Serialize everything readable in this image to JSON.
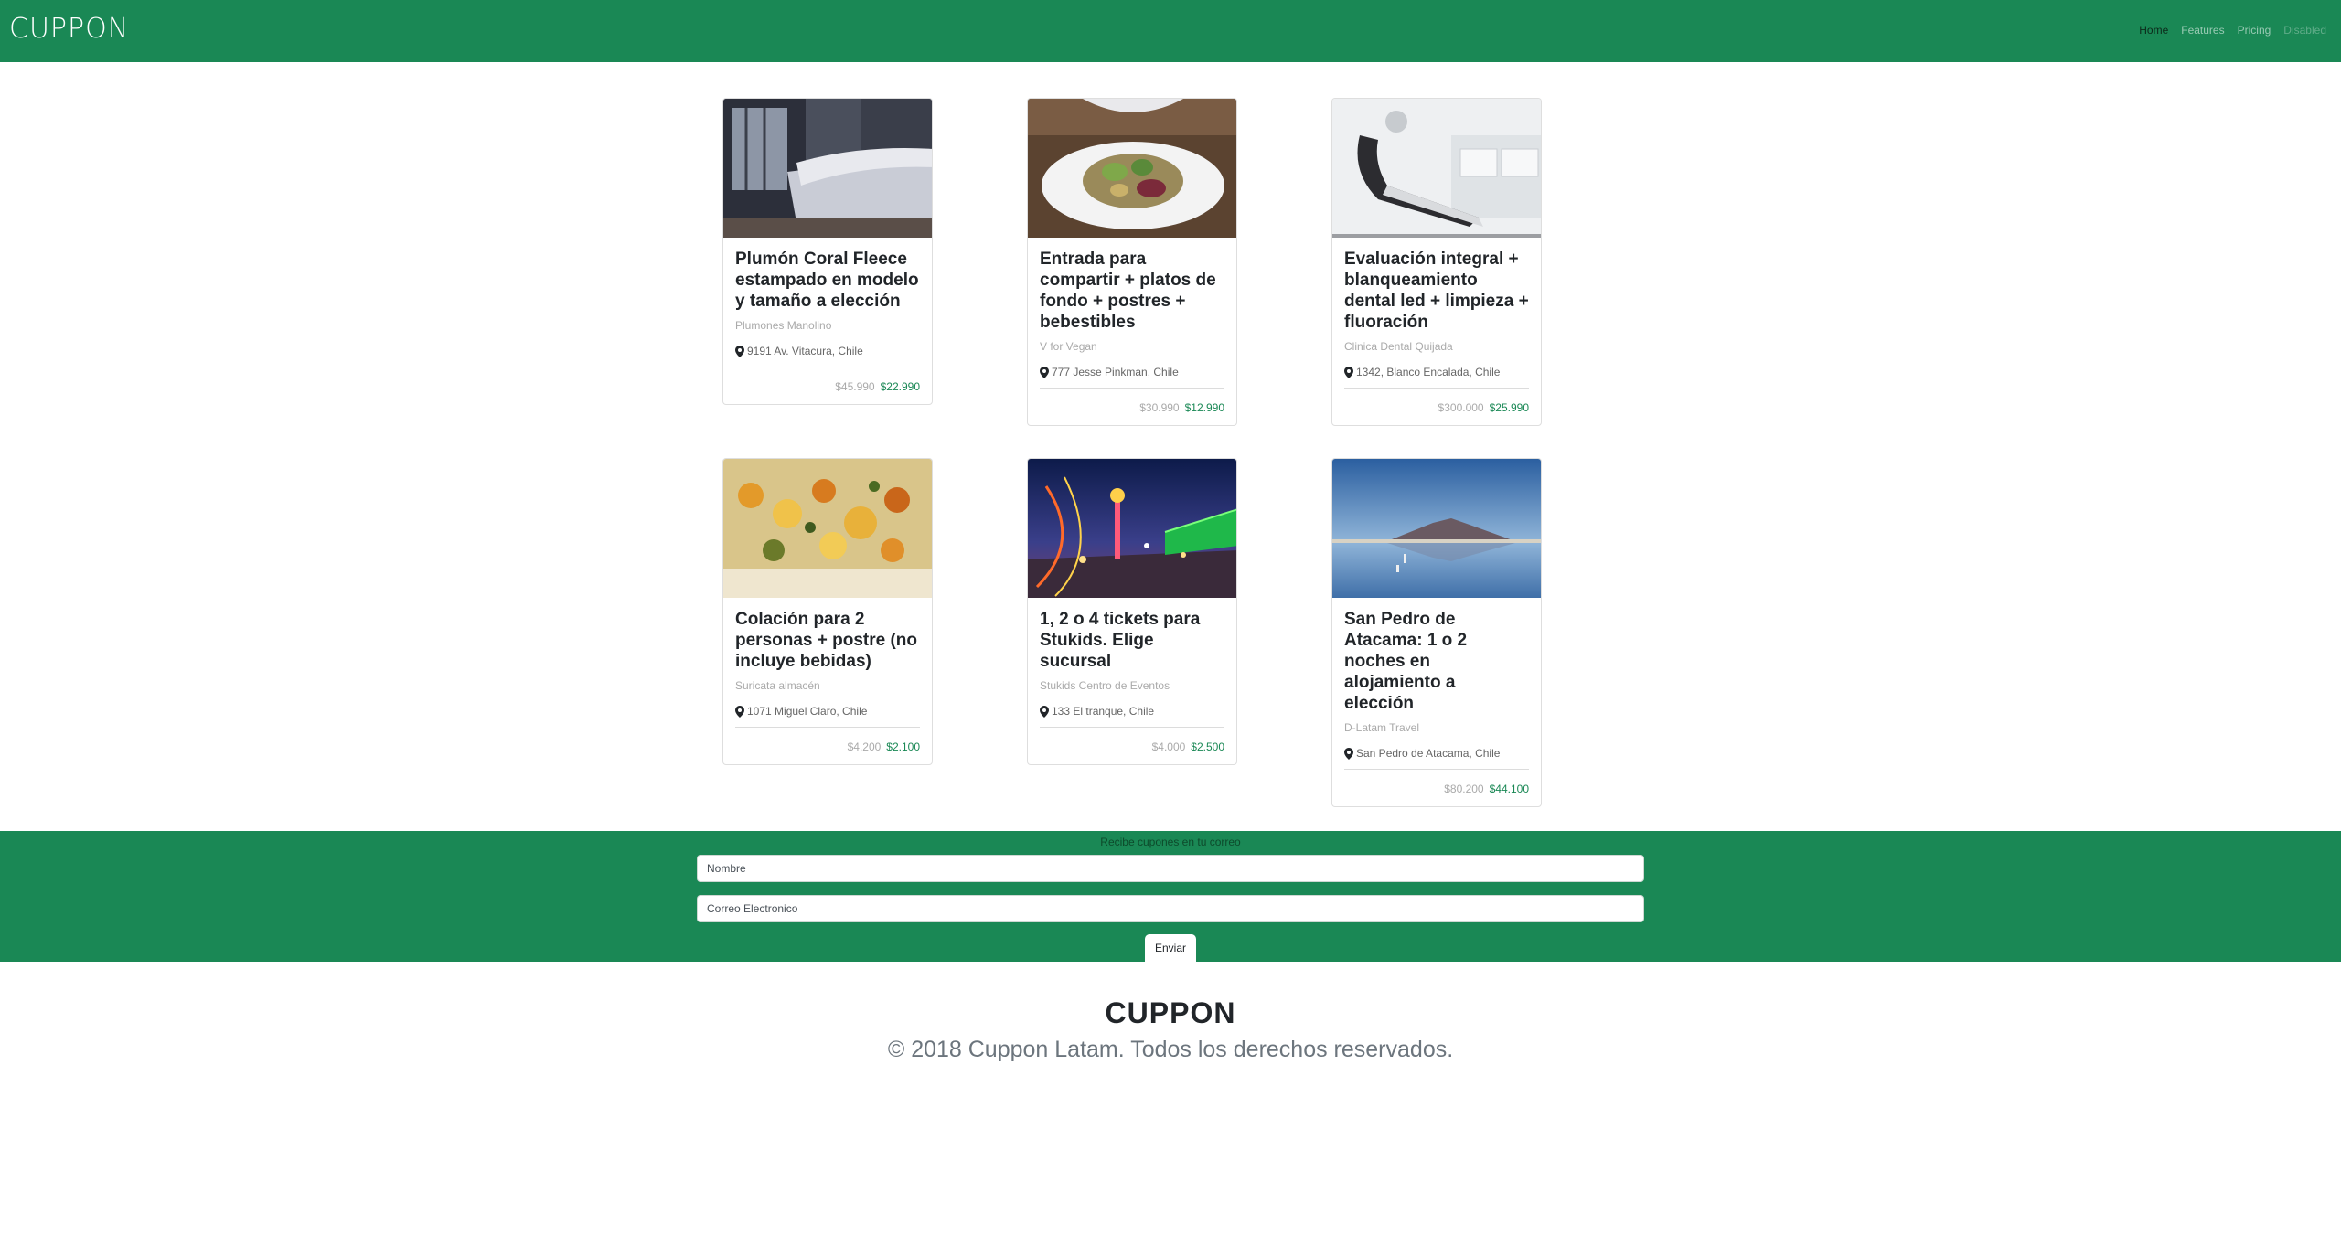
{
  "navbar": {
    "brand": "CUPPON",
    "links": [
      {
        "label": "Home"
      },
      {
        "label": "Features"
      },
      {
        "label": "Pricing"
      },
      {
        "label": "Disabled"
      }
    ]
  },
  "cards": [
    {
      "title": "Plumón Coral Fleece estampado en modelo y tamaño a elección",
      "merchant": "Plumones Manolino",
      "location": "9191 Av. Vitacura, Chile",
      "price_old": "$45.990",
      "price_new": "$22.990"
    },
    {
      "title": "Entrada para compartir + platos de fondo + postres + bebestibles",
      "merchant": "V for Vegan",
      "location": "777 Jesse Pinkman, Chile",
      "price_old": "$30.990",
      "price_new": "$12.990"
    },
    {
      "title": "Evaluación integral + blanqueamiento dental led + limpieza + fluoración",
      "merchant": "Clinica Dental Quijada",
      "location": "1342, Blanco Encalada, Chile",
      "price_old": "$300.000",
      "price_new": "$25.990"
    },
    {
      "title": "Colación para 2 personas + postre (no incluye bebidas)",
      "merchant": "Suricata almacén",
      "location": "1071 Miguel Claro, Chile",
      "price_old": "$4.200",
      "price_new": "$2.100"
    },
    {
      "title": "1, 2 o 4 tickets para Stukids. Elige sucursal",
      "merchant": "Stukids Centro de Eventos",
      "location": "133 El tranque, Chile",
      "price_old": "$4.000",
      "price_new": "$2.500"
    },
    {
      "title": "San Pedro de Atacama: 1 o 2 noches en alojamiento a elección",
      "merchant": "D-Latam Travel",
      "location": "San Pedro de Atacama, Chile",
      "price_old": "$80.200",
      "price_new": "$44.100"
    }
  ],
  "newsletter": {
    "label": "Recibe cupones en tu correo",
    "name_placeholder": "Nombre",
    "email_placeholder": "Correo Electronico",
    "submit_label": "Enviar"
  },
  "footer": {
    "brand": "CUPPON",
    "copyright": "© 2018 Cuppon Latam. Todos los derechos reservados."
  },
  "colors": {
    "primary_green": "#1a8855",
    "price_new": "#1a8855"
  }
}
